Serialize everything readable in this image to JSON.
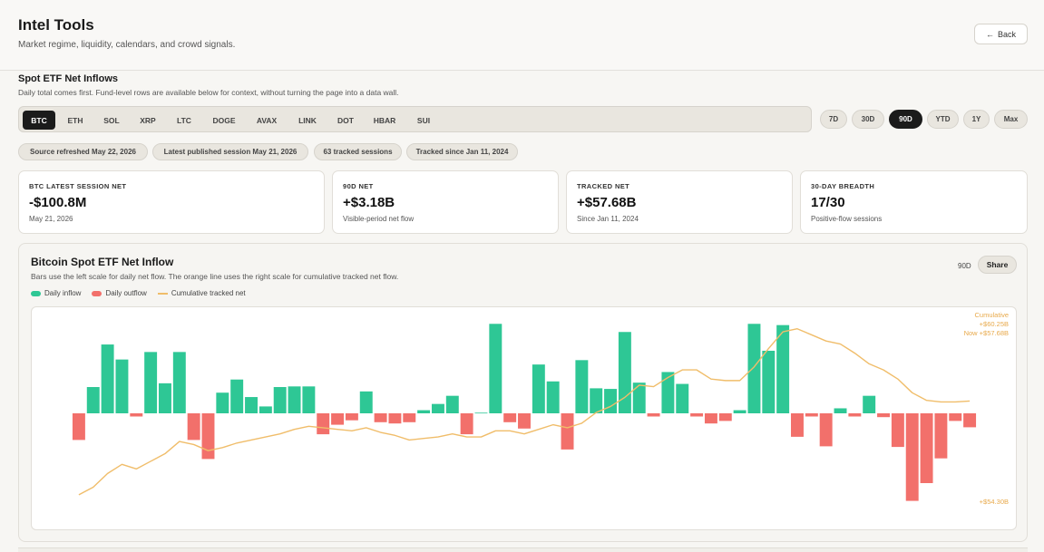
{
  "header": {
    "title": "Intel Tools",
    "subtitle": "Market regime, liquidity, calendars, and crowd signals.",
    "back_label": "Back"
  },
  "section": {
    "title": "Spot ETF Net Inflows",
    "description": "Daily total comes first. Fund-level rows are available below for context, without turning the page into a data wall."
  },
  "assets": {
    "items": [
      "BTC",
      "ETH",
      "SOL",
      "XRP",
      "LTC",
      "DOGE",
      "AVAX",
      "LINK",
      "DOT",
      "HBAR",
      "SUI"
    ],
    "selected": "BTC"
  },
  "ranges": {
    "items": [
      "7D",
      "30D",
      "90D",
      "YTD",
      "1Y",
      "Max"
    ],
    "selected": "90D"
  },
  "meta_chips": [
    "Source refreshed May 22, 2026",
    "Latest published session May 21, 2026",
    "63 tracked sessions",
    "Tracked since Jan 11, 2024"
  ],
  "stats": [
    {
      "label": "BTC LATEST SESSION NET",
      "value": "-$100.8M",
      "sub": "May 21, 2026"
    },
    {
      "label": "90D NET",
      "value": "+$3.18B",
      "sub": "Visible-period net flow"
    },
    {
      "label": "TRACKED NET",
      "value": "+$57.68B",
      "sub": "Since Jan 11, 2024"
    },
    {
      "label": "30-DAY BREADTH",
      "value": "17/30",
      "sub": "Positive-flow sessions"
    }
  ],
  "chart": {
    "title": "Bitcoin Spot ETF Net Inflow",
    "description": "Bars use the left scale for daily net flow. The orange line uses the right scale for cumulative tracked net flow.",
    "range_tag": "90D",
    "share_label": "Share",
    "legend": [
      "Daily inflow",
      "Daily outflow",
      "Cumulative tracked net"
    ],
    "right_axis": {
      "title": "Cumulative",
      "top": "+$60.25B",
      "now": "Now +$57.68B",
      "bottom": "+$54.30B"
    }
  },
  "colors": {
    "inflow": "#2ec795",
    "outflow": "#f2706b",
    "cumulative": "#f0bd6a",
    "accent_dark": "#1b1b1b"
  },
  "chart_data": {
    "type": "bar",
    "series": [
      {
        "name": "Daily inflow",
        "values": [
          -42,
          42,
          110,
          86,
          -5,
          98,
          48,
          98,
          -42,
          -72,
          33,
          54,
          26,
          11,
          42,
          43,
          43,
          -33,
          -18,
          -11,
          35,
          -14,
          -16,
          -14,
          5,
          15,
          28,
          -33,
          1,
          143,
          -14,
          -24,
          78,
          51,
          -57,
          85,
          40,
          39,
          130,
          49,
          -5,
          66,
          47,
          -5,
          -16,
          -12,
          5,
          143,
          100,
          141,
          -37,
          -5,
          -52,
          8,
          -5,
          28,
          -6,
          -53,
          -138,
          -110,
          -71,
          -12,
          -22
        ]
      },
      {
        "name": "Cumulative tracked net",
        "values": [
          54.6,
          54.85,
          55.3,
          55.6,
          55.45,
          55.7,
          55.95,
          56.35,
          56.25,
          56.05,
          56.15,
          56.3,
          56.4,
          56.5,
          56.6,
          56.75,
          56.85,
          56.8,
          56.75,
          56.7,
          56.8,
          56.65,
          56.55,
          56.4,
          56.45,
          56.5,
          56.6,
          56.5,
          56.5,
          56.7,
          56.7,
          56.6,
          56.75,
          56.9,
          56.8,
          56.95,
          57.3,
          57.5,
          57.8,
          58.2,
          58.15,
          58.45,
          58.7,
          58.7,
          58.4,
          58.35,
          58.35,
          58.8,
          59.4,
          59.95,
          60.05,
          59.85,
          59.65,
          59.55,
          59.25,
          58.9,
          58.7,
          58.4,
          57.95,
          57.7,
          57.65,
          57.65,
          57.68
        ]
      }
    ],
    "title": "Bitcoin Spot ETF Net Inflow",
    "y_left_unit": "$M",
    "y_right_unit": "$B",
    "ylim_left": [
      -150,
      155
    ],
    "ylim_right": [
      54.3,
      60.25
    ],
    "grid": false,
    "legend_position": "top-left"
  }
}
